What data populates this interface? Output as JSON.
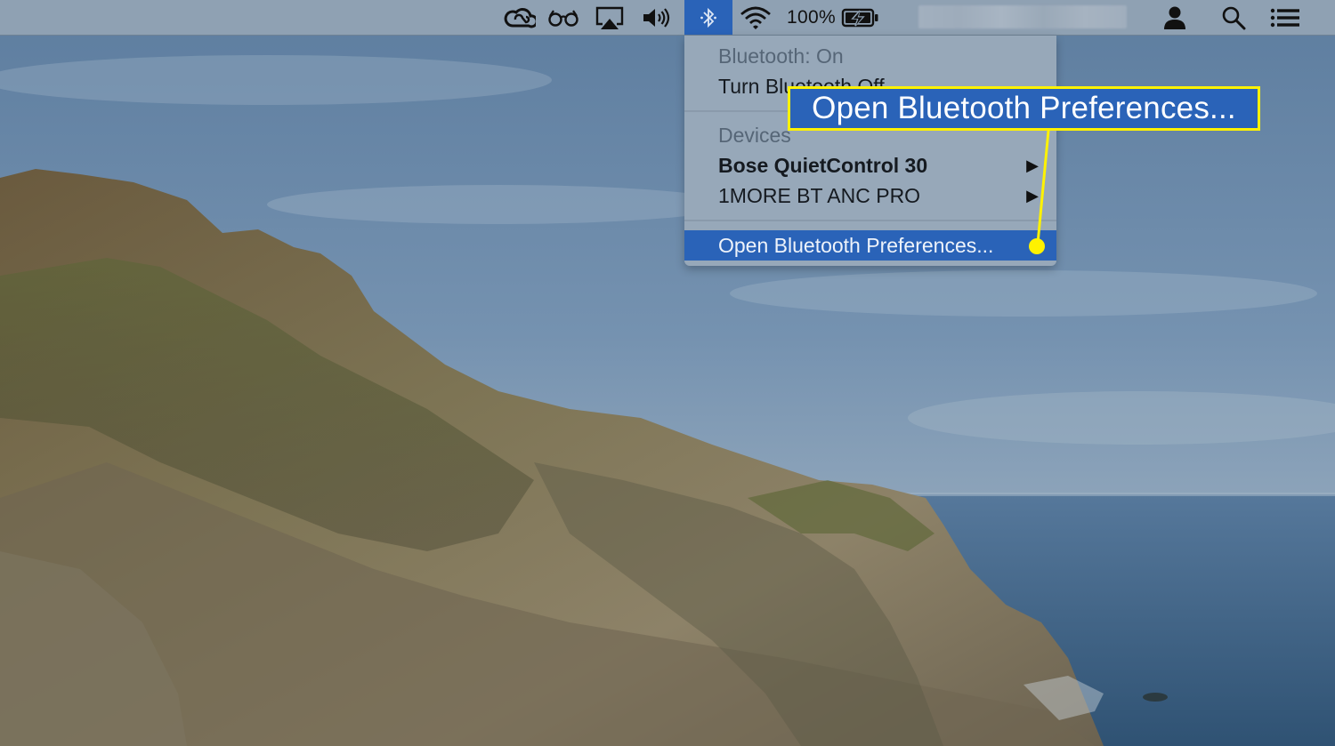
{
  "menubar": {
    "items": [
      {
        "name": "creative-cloud",
        "icon": "creative-cloud-icon"
      },
      {
        "name": "accessibility-glasses",
        "icon": "glasses-icon"
      },
      {
        "name": "airplay",
        "icon": "airplay-icon"
      },
      {
        "name": "volume",
        "icon": "speaker-icon"
      },
      {
        "name": "bluetooth",
        "icon": "bluetooth-icon",
        "active": true
      },
      {
        "name": "wifi",
        "icon": "wifi-icon"
      },
      {
        "name": "battery",
        "icon": "battery-charging-icon"
      },
      {
        "name": "user",
        "icon": "user-icon"
      },
      {
        "name": "spotlight",
        "icon": "search-icon"
      },
      {
        "name": "notification-center",
        "icon": "list-icon"
      }
    ],
    "battery_percent": "100%"
  },
  "bluetooth_menu": {
    "status": "Bluetooth: On",
    "toggle_label": "Turn Bluetooth Off",
    "devices_header": "Devices",
    "devices": [
      {
        "name": "Bose QuietControl 30",
        "connected": true
      },
      {
        "name": "1MORE BT ANC PRO",
        "connected": false
      }
    ],
    "open_prefs_label": "Open Bluetooth Preferences..."
  },
  "callout": {
    "text": "Open Bluetooth Preferences..."
  },
  "colors": {
    "menubar": "#8fa1b3",
    "menu_bg": "#97a8b9",
    "highlight": "#2a63b8",
    "callout_border": "#fff200"
  }
}
